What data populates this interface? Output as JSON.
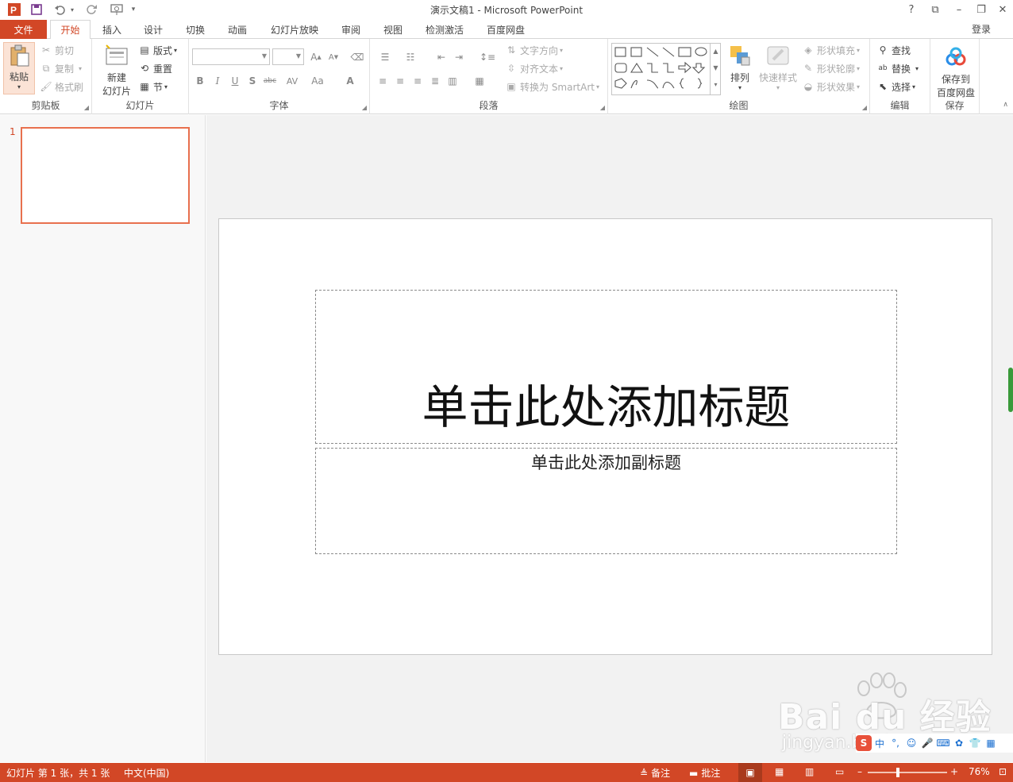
{
  "window": {
    "title": "演示文稿1 - Microsoft PowerPoint",
    "help": "?",
    "restore_ribbon": "⧉",
    "minimize": "–",
    "maximize": "❐",
    "close": "✕"
  },
  "quick_access": {
    "app_icon": "P",
    "save_icon": "save-icon",
    "undo_icon": "undo-icon",
    "redo_icon": "redo-icon",
    "present_icon": "present-icon"
  },
  "tabs": {
    "file": "文件",
    "items": [
      "开始",
      "插入",
      "设计",
      "切换",
      "动画",
      "幻灯片放映",
      "审阅",
      "视图",
      "检测激活",
      "百度网盘"
    ],
    "active": "开始",
    "login": "登录"
  },
  "ribbon": {
    "clipboard": {
      "label": "剪贴板",
      "paste": "粘贴",
      "cut": "剪切",
      "copy": "复制",
      "format_painter": "格式刷"
    },
    "slides": {
      "label": "幻灯片",
      "new_slide_line1": "新建",
      "new_slide_line2": "幻灯片",
      "layout": "版式",
      "reset": "重置",
      "section": "节"
    },
    "font": {
      "label": "字体",
      "font_name": "",
      "font_size": "",
      "bold": "B",
      "italic": "I",
      "underline": "U",
      "shadow": "S",
      "strike": "abc",
      "spacing": "AV",
      "case": "Aa",
      "color": "A"
    },
    "paragraph": {
      "label": "段落",
      "text_direction": "文字方向",
      "align_text": "对齐文本",
      "smartart": "转换为 SmartArt"
    },
    "drawing": {
      "label": "绘图",
      "arrange": "排列",
      "quick_styles": "快速样式",
      "shape_fill": "形状填充",
      "shape_outline": "形状轮廓",
      "shape_effects": "形状效果"
    },
    "editing": {
      "label": "编辑",
      "find": "查找",
      "replace": "替换",
      "select": "选择"
    },
    "save": {
      "label": "保存",
      "save_to_line1": "保存到",
      "save_to_line2": "百度网盘"
    }
  },
  "thumbnails": {
    "slide_number": "1"
  },
  "slide": {
    "title_placeholder": "单击此处添加标题",
    "subtitle_placeholder": "单击此处添加副标题"
  },
  "watermark": {
    "brand": "Bai du 经验",
    "url": "jingyan.baidu.com"
  },
  "ime": {
    "logo": "S",
    "mode": "中"
  },
  "statusbar": {
    "slide_info": "幻灯片 第 1 张，共 1 张",
    "language": "中文(中国)",
    "notes": "备注",
    "comments": "批注",
    "zoom_minus": "–",
    "zoom_plus": "+",
    "zoom": "76%",
    "zoom_percent": 76
  },
  "colors": {
    "accent": "#d24726",
    "thumb_border": "#e8704e"
  }
}
